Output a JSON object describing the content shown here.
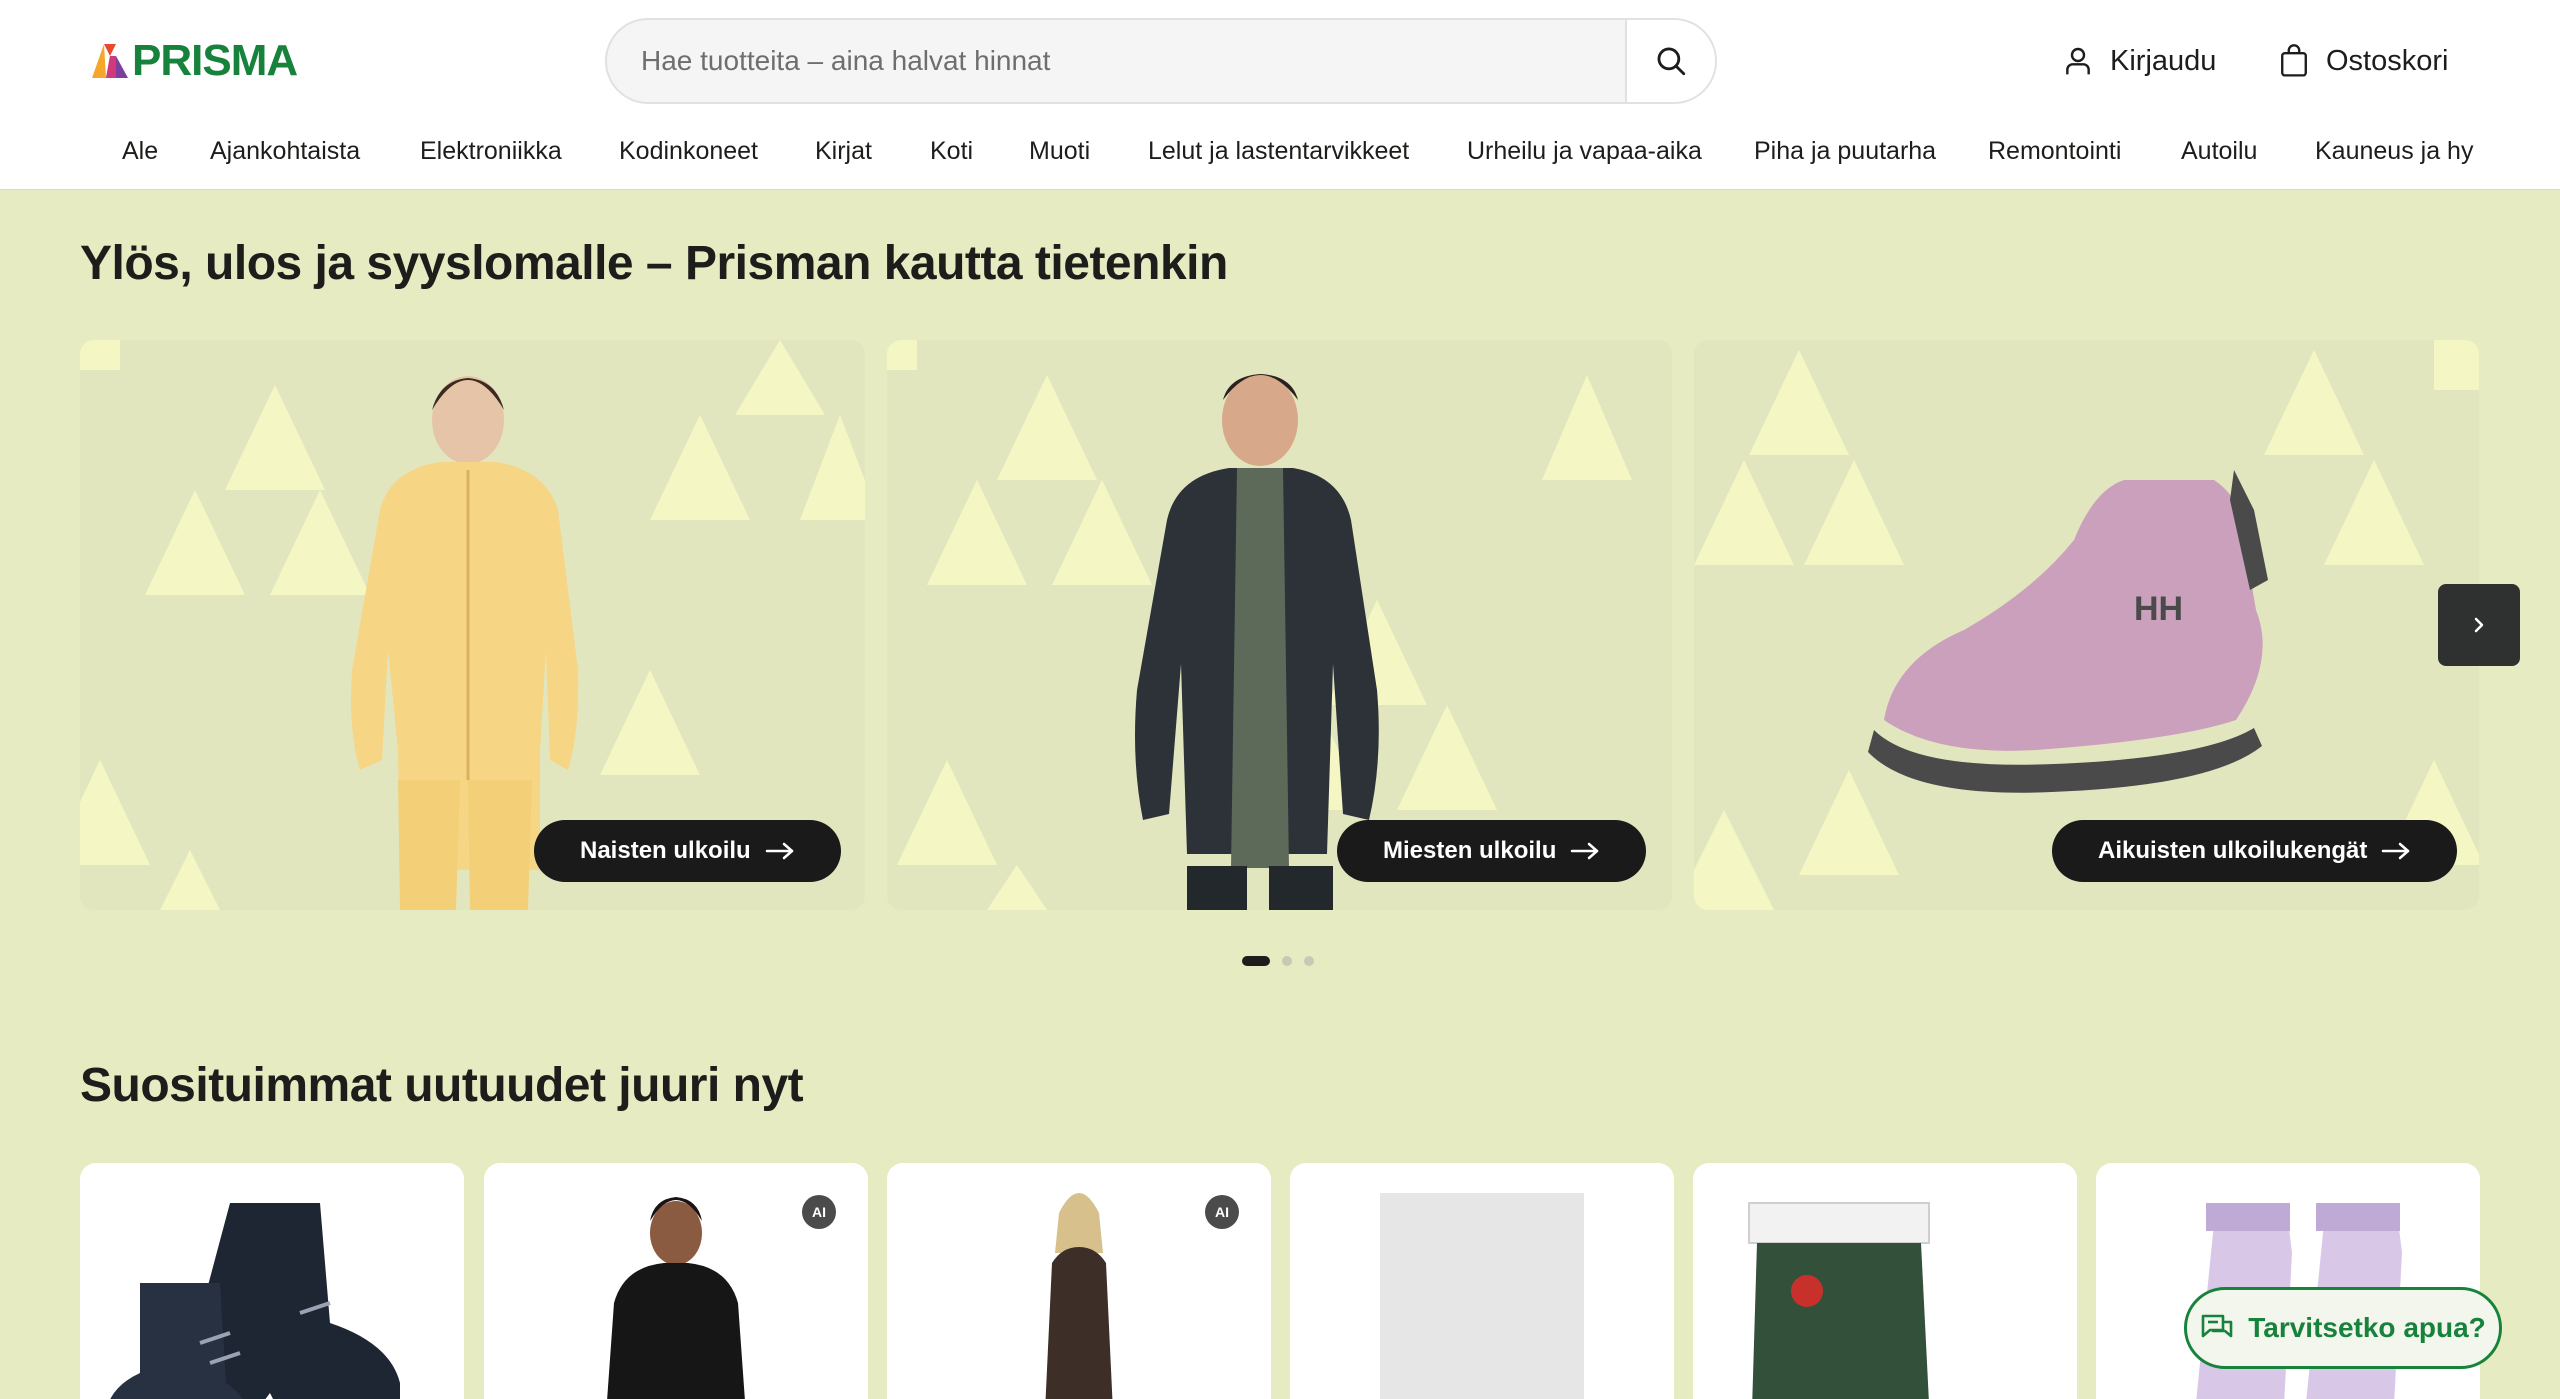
{
  "brand": {
    "name": "PRISMA",
    "color": "#17823b"
  },
  "search": {
    "placeholder": "Hae tuotteita – aina halvat hinnat",
    "icon": "search-icon"
  },
  "header": {
    "login_label": "Kirjaudu",
    "cart_label": "Ostoskori"
  },
  "nav": {
    "items": [
      "Ale",
      "Ajankohtaista",
      "Elektroniikka",
      "Kodinkoneet",
      "Kirjat",
      "Koti",
      "Muoti",
      "Lelut ja lastentarvikkeet",
      "Urheilu ja vapaa-aika",
      "Piha ja puutarha",
      "Remontointi",
      "Autoilu",
      "Kauneus ja hy"
    ]
  },
  "hero": {
    "title": "Ylös, ulos ja syyslomalle – Prisman kautta tietenkin",
    "cards": [
      {
        "button_label": "Naisten ulkoilu"
      },
      {
        "button_label": "Miesten ulkoilu"
      },
      {
        "button_label": "Aikuisten ulkoilukengät"
      }
    ],
    "slide_index": 1,
    "slide_count": 3
  },
  "new_products": {
    "title": "Suosituimmat uutuudet juuri nyt",
    "badge_label": "AI"
  },
  "help": {
    "label": "Tarvitsetko apua?"
  },
  "colors": {
    "hero_bg": "#e7ebc2",
    "triangle": "#f4f7c4",
    "button_dark": "#1a1a1a"
  }
}
